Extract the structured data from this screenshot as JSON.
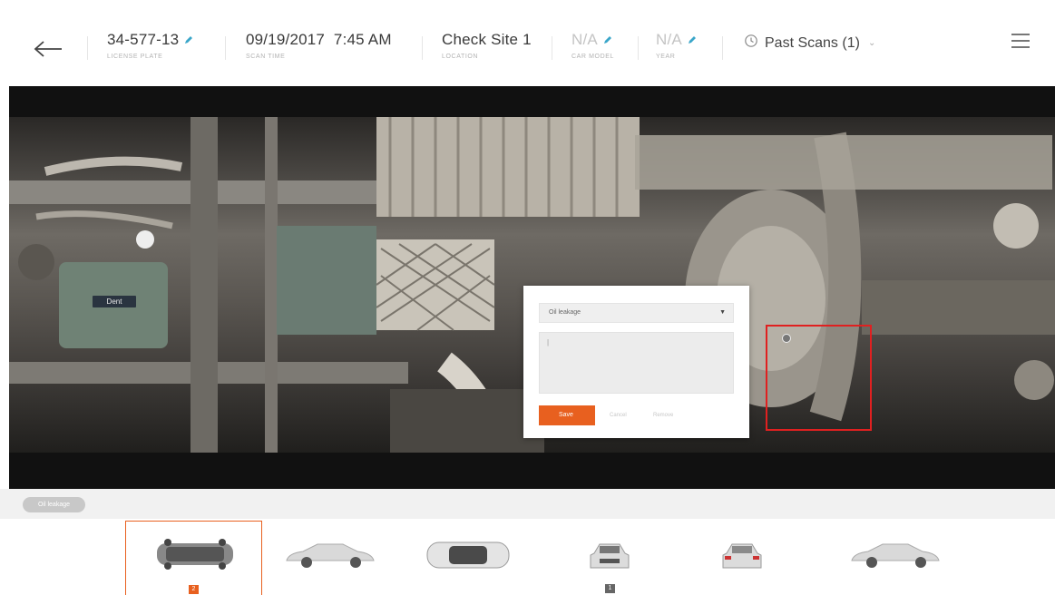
{
  "header": {
    "back_icon": "arrow-left-icon",
    "fields": [
      {
        "value": "34-577-13",
        "label": "LICENSE PLATE",
        "editable": true
      },
      {
        "value": "09/19/2017  7:45 AM",
        "label": "SCAN TIME",
        "editable": false
      },
      {
        "value": "Check Site 1",
        "label": "LOCATION",
        "editable": false
      },
      {
        "value": "N/A",
        "label": "CAR MODEL",
        "editable": true
      },
      {
        "value": "N/A",
        "label": "YEAR",
        "editable": true
      }
    ],
    "past_scans": "Past Scans (1)",
    "past_scans_icon": "history-clock-icon",
    "menu_icon": "hamburger-menu-icon"
  },
  "viewer": {
    "dent_label": "Dent",
    "popup": {
      "select_value": "Oil leakage",
      "note_text": "|",
      "save_label": "Save",
      "cancel_label": "Cancel",
      "remove_label": "Remove"
    }
  },
  "tag_chip": "Oil leakage",
  "thumbnails": [
    {
      "name": "underbody",
      "badge": "2",
      "badge_color": "#e8601f",
      "active": true
    },
    {
      "name": "side-left",
      "badge": null,
      "active": false
    },
    {
      "name": "top",
      "badge": null,
      "active": false
    },
    {
      "name": "front",
      "badge": "1",
      "badge_color": "#666666",
      "active": false
    },
    {
      "name": "rear",
      "badge": null,
      "active": false
    },
    {
      "name": "side-right",
      "badge": null,
      "active": false
    }
  ],
  "colors": {
    "accent": "#e8601f",
    "marker": "#e02020"
  }
}
